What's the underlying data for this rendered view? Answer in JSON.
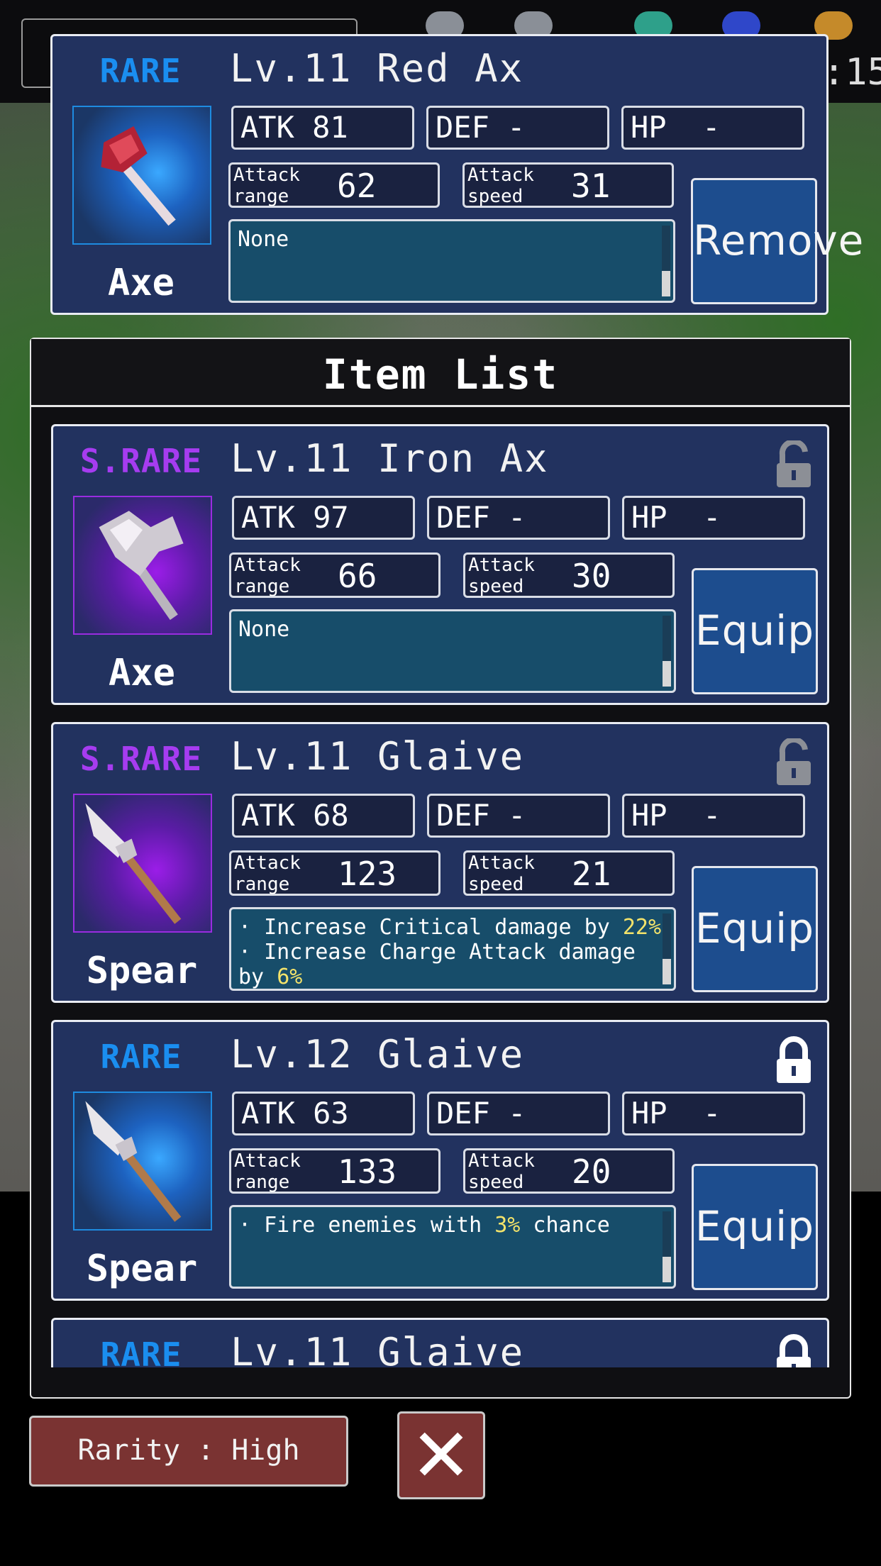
{
  "equipped": {
    "rarity": "RARE",
    "rarity_class": "rare",
    "name": "Lv.11 Red Ax",
    "type": "Axe",
    "icon": "red-axe-icon",
    "atk": "ATK 81",
    "def": "DEF -",
    "hp": "HP  -",
    "range_label": "Attack range",
    "range": "62",
    "speed_label": "Attack speed",
    "speed": "31",
    "desc": "None",
    "action": "Remove"
  },
  "header": {
    "title": "Item List",
    "counter": ":15"
  },
  "items": [
    {
      "rarity": "S.RARE",
      "name": "Lv.11 Iron Ax",
      "type": "Axe",
      "icon": "iron-axe-icon",
      "atk": "ATK 97",
      "def": "DEF -",
      "hp": "HP  -",
      "range_label": "Attack range",
      "range": "66",
      "speed_label": "Attack speed",
      "speed": "30",
      "desc": "None",
      "action": "Equip",
      "lock": "unlocked"
    },
    {
      "rarity": "S.RARE",
      "name": "Lv.11 Glaive",
      "type": "Spear",
      "icon": "glaive-icon",
      "atk": "ATK 68",
      "def": "DEF -",
      "hp": "HP  -",
      "range_label": "Attack range",
      "range": "123",
      "speed_label": "Attack speed",
      "speed": "21",
      "desc_lines": [
        {
          "text": "· Increase Critical damage by ",
          "value": "22%"
        },
        {
          "text": "· Increase Charge Attack damage by ",
          "value": "6%"
        }
      ],
      "action": "Equip",
      "lock": "unlocked"
    },
    {
      "rarity": "RARE",
      "name": "Lv.12 Glaive",
      "type": "Spear",
      "icon": "glaive-icon",
      "atk": "ATK 63",
      "def": "DEF -",
      "hp": "HP  -",
      "range_label": "Attack range",
      "range": "133",
      "speed_label": "Attack speed",
      "speed": "20",
      "desc_lines": [
        {
          "text": "· Fire enemies with ",
          "value": "3%",
          "suffix": " chance"
        }
      ],
      "action": "Equip",
      "lock": "locked"
    },
    {
      "rarity": "RARE",
      "name": "Lv.11 Glaive",
      "lock": "locked"
    }
  ],
  "footer": {
    "filter_label": "Rarity : High",
    "close_label": "✕"
  },
  "colors": {
    "panel": "#22325f",
    "rare": "#1a8ef0",
    "srare": "#a63cf0",
    "button_blue": "#1d4d8e",
    "button_red": "#7a3332",
    "highlight": "#f4e36a"
  }
}
